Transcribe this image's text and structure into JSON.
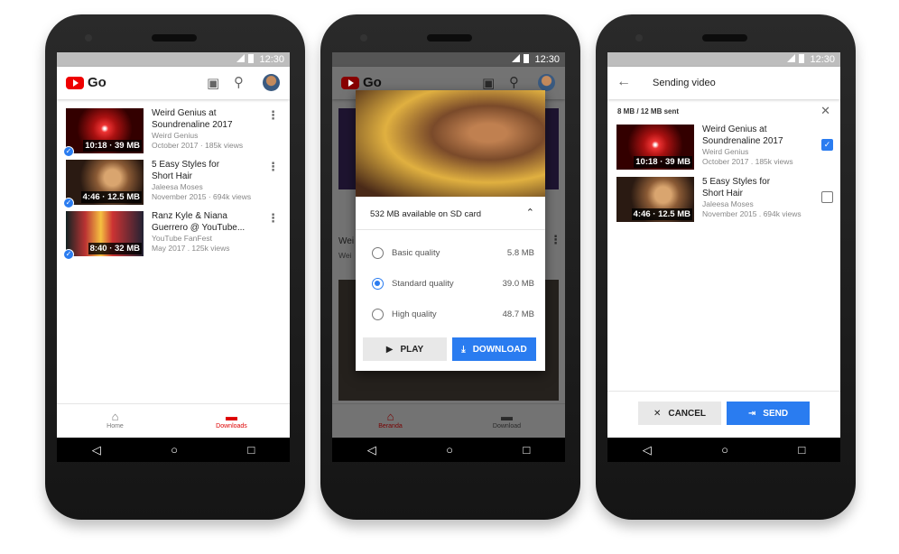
{
  "status_time": "12:30",
  "app_name": "Go",
  "videos": [
    {
      "title1": "Weird Genius at",
      "title2": "Soundrenaline 2017",
      "channel": "Weird Genius",
      "info": "October 2017 · 185k views",
      "badge": "10:18 · 39 MB"
    },
    {
      "title1": "5 Easy Styles for",
      "title2": "Short Hair",
      "channel": "Jaleesa Moses",
      "info": "November 2015  · 694k views",
      "badge": "4:46 · 12.5 MB"
    },
    {
      "title1": "Ranz Kyle & Niana",
      "title2": "Guerrero @ YouTube...",
      "channel": "YouTube FanFest",
      "info": "May 2017 . 125k views",
      "badge": "8:40 · 32 MB"
    }
  ],
  "phone1_nav": {
    "home": "Home",
    "downloads": "Downloads"
  },
  "phone2": {
    "bg_title_partial": "Wei",
    "bg_channel_partial": "Wei",
    "storage": "532 MB available on SD card",
    "options": [
      {
        "label": "Basic quality",
        "size": "5.8 MB",
        "selected": false
      },
      {
        "label": "Standard quality",
        "size": "39.0 MB",
        "selected": true
      },
      {
        "label": "High quality",
        "size": "48.7 MB",
        "selected": false
      }
    ],
    "play": "PLAY",
    "download": "DOWNLOAD",
    "nav": {
      "home": "Beranda",
      "downloads": "Download"
    }
  },
  "phone3": {
    "title": "Sending video",
    "progress": "8 MB / 12 MB sent",
    "items": [
      {
        "title1": "Weird Genius at",
        "title2": "Soundrenaline 2017",
        "channel": "Weird Genius",
        "info": "October 2017 . 185k views",
        "badge": "10:18 · 39 MB",
        "checked": true
      },
      {
        "title1": "5 Easy Styles for",
        "title2": "Short Hair",
        "channel": "Jaleesa Moses",
        "info": "November 2015  . 694k views",
        "badge": "4:46 · 12.5 MB",
        "checked": false
      }
    ],
    "cancel": "CANCEL",
    "send": "SEND"
  },
  "colors": {
    "accent": "#2a7cf0",
    "brand": "#e00000",
    "nav_active": "#d00000"
  }
}
